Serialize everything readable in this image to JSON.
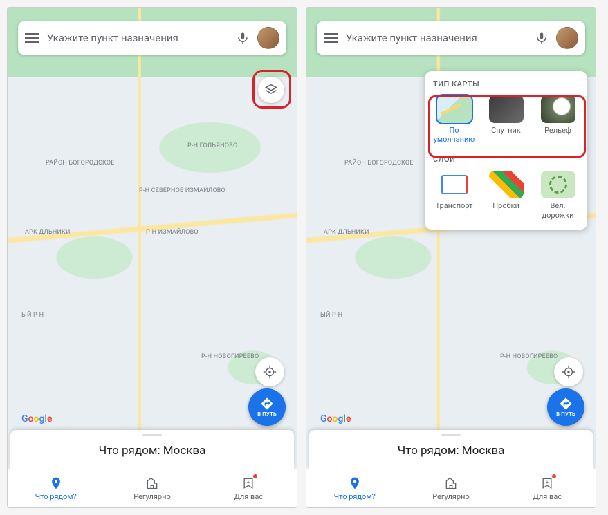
{
  "search": {
    "placeholder": "Укажите пункт назначения"
  },
  "map_labels": {
    "bogorodskoye": "РАЙОН\nБОГОРОДСКОЕ",
    "golyanovo": "Р-Н ГОЛЬЯНОВО",
    "sev_izmailovo": "Р-Н СЕВЕРНОЕ\nИЗМАЙЛОВО",
    "izmailovo": "Р-Н ИЗМАЙЛОВО",
    "park_olniki": "АРК\nДЛЬНИКИ",
    "yn_rn": "ЫЙ Р-Н",
    "novogireevo": "Р-Н НОВОГИРЕЕВО"
  },
  "go_btn": {
    "label": "В ПУТЬ"
  },
  "watermark": "Google",
  "sheet": {
    "title": "Что рядом: Москва"
  },
  "tabs": [
    {
      "label": "Что рядом?",
      "icon": "pin",
      "active": true
    },
    {
      "label": "Регулярно",
      "icon": "building",
      "active": false
    },
    {
      "label": "Для вас",
      "icon": "star-badge",
      "active": false
    }
  ],
  "layers_panel": {
    "map_type_heading": "ТИП КАРТЫ",
    "layers_heading": "СЛОИ",
    "map_types": [
      {
        "label": "По умолчанию",
        "key": "default",
        "selected": true
      },
      {
        "label": "Спутник",
        "key": "satellite",
        "selected": false
      },
      {
        "label": "Рельеф",
        "key": "terrain",
        "selected": false
      }
    ],
    "layer_options": [
      {
        "label": "Транспорт",
        "key": "transit"
      },
      {
        "label": "Пробки",
        "key": "traffic"
      },
      {
        "label": "Вел. дорожки",
        "key": "bike"
      }
    ]
  }
}
